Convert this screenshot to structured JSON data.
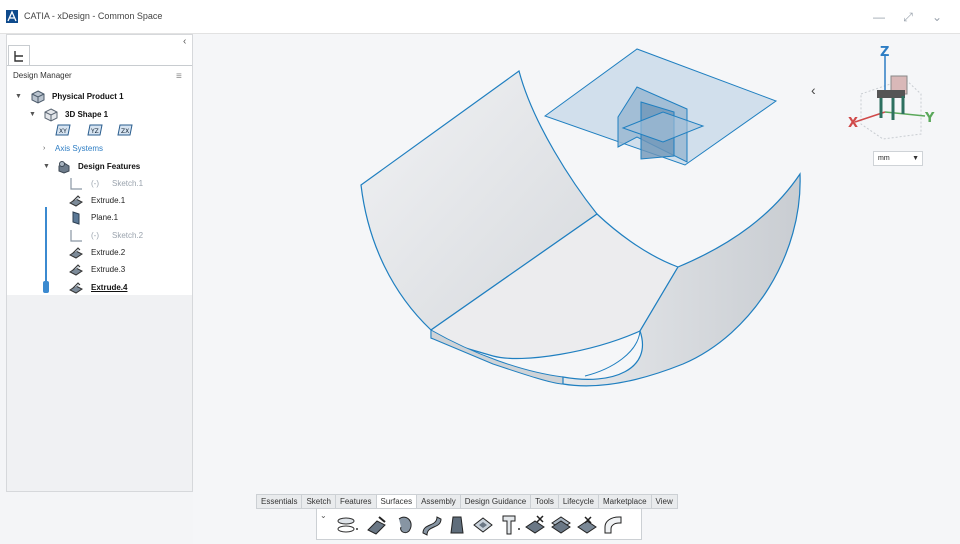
{
  "window": {
    "title": "CATIA - xDesign - Common Space"
  },
  "tree": {
    "panel_title": "Design Manager",
    "nodes": {
      "physical_product": "Physical Product 1",
      "shape": "3D Shape 1",
      "plane_xy": "XY",
      "plane_yz": "YZ",
      "plane_zx": "ZX",
      "axis_systems": "Axis Systems",
      "design_features": "Design Features",
      "sketch1": "Sketch.1",
      "extrude1": "Extrude.1",
      "plane1": "Plane.1",
      "sketch2": "Sketch.2",
      "extrude2": "Extrude.2",
      "extrude3": "Extrude.3",
      "extrude4": "Extrude.4"
    },
    "hidden_marker": "(-)"
  },
  "compass": {
    "z": "Z",
    "x": "X",
    "y": "Y"
  },
  "units": {
    "selected": "mm"
  },
  "action_bar": {
    "tabs": [
      "Essentials",
      "Sketch",
      "Features",
      "Surfaces",
      "Assembly",
      "Design Guidance",
      "Tools",
      "Lifecycle",
      "Marketplace",
      "View"
    ],
    "active_tab": "Surfaces"
  },
  "colors": {
    "accent": "#3b8ad0",
    "edge": "#1f7fc0",
    "surface": "#e8eaec"
  }
}
